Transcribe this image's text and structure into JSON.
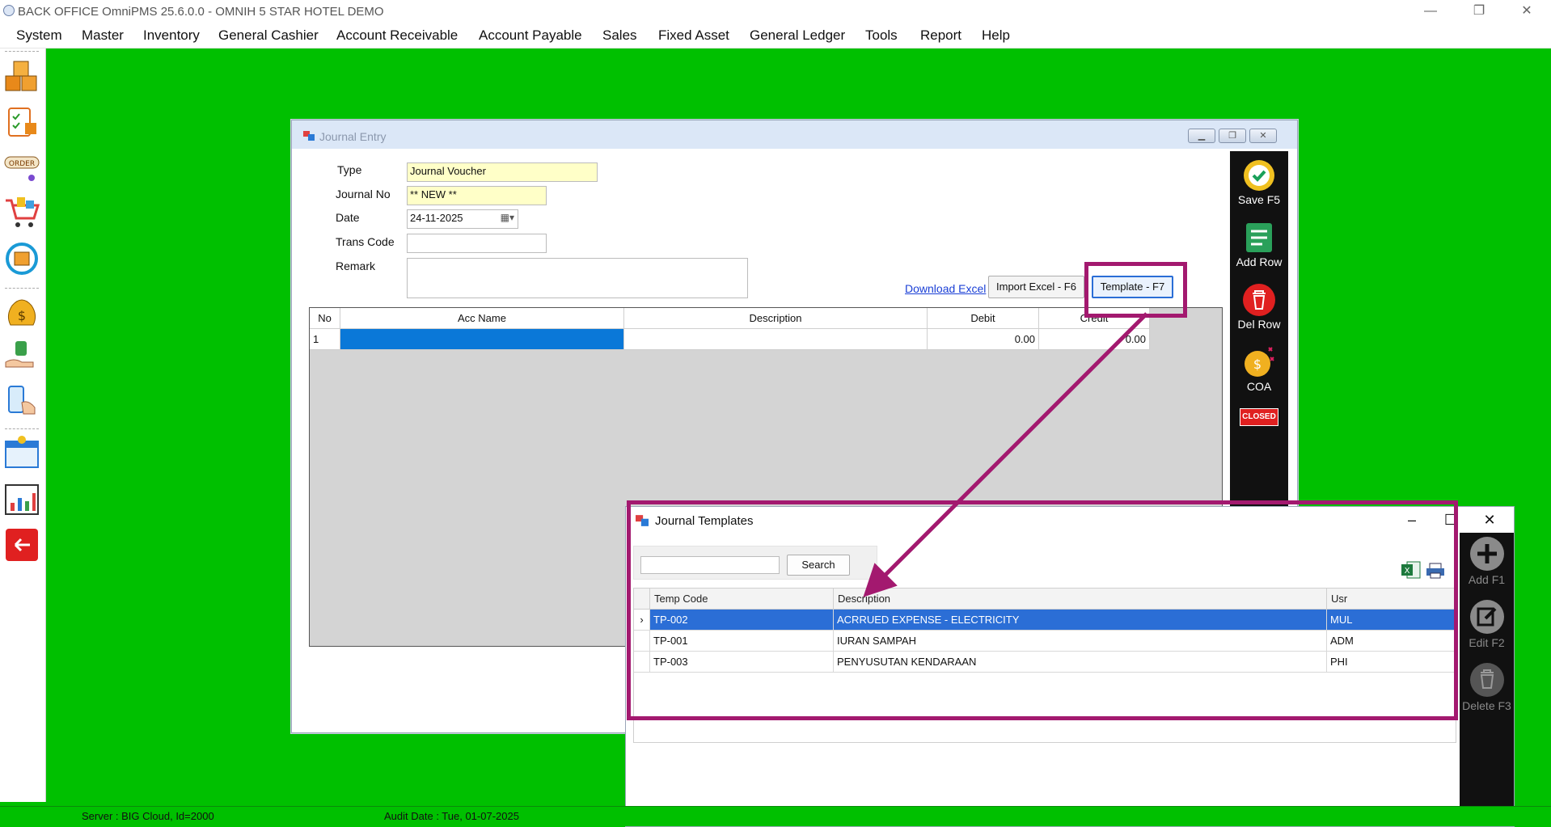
{
  "app": {
    "title": "BACK OFFICE OmniPMS 25.6.0.0 - OMNIH 5 STAR HOTEL DEMO",
    "window_controls": {
      "minimize": "—",
      "restore": "❐",
      "close": "✕"
    }
  },
  "menu": [
    "System",
    "Master",
    "Inventory",
    "General Cashier",
    "Account Receivable",
    "Account Payable",
    "Sales",
    "Fixed Asset",
    "General Ledger",
    "Tools",
    "Report",
    "Help"
  ],
  "left_toolbar": [
    "inventory-boxes-icon",
    "clipboard-task-icon",
    "order-icon",
    "shopping-cart-icon",
    "sync-package-icon",
    "money-bag-icon",
    "payment-hand-icon",
    "mobile-touch-icon",
    "calendar-report-icon",
    "chart-report-icon",
    "exit-icon"
  ],
  "status": {
    "server": "Server : BIG Cloud, Id=2000",
    "audit_date": "Audit Date : Tue, 01-07-2025"
  },
  "journal_entry": {
    "title": "Journal Entry",
    "labels": {
      "type": "Type",
      "journal_no": "Journal No",
      "date": "Date",
      "trans_code": "Trans Code",
      "remark": "Remark"
    },
    "values": {
      "type": "Journal Voucher",
      "journal_no": "** NEW **",
      "date": "24-11-2025",
      "trans_code": "",
      "remark": ""
    },
    "download_excel": "Download Excel",
    "import_button": "Import Excel - F6",
    "template_button": "Template - F7",
    "grid": {
      "columns": [
        "No",
        "Acc Name",
        "Description",
        "Debit",
        "Credit"
      ],
      "rows": [
        {
          "no": "1",
          "acc_name": "",
          "description": "",
          "debit": "0.00",
          "credit": "0.00"
        }
      ]
    },
    "toolbar": {
      "save": "Save F5",
      "add_row": "Add Row",
      "del_row": "Del Row",
      "coa": "COA",
      "closed": "CLOSED"
    }
  },
  "templates_dialog": {
    "title": "Journal Templates",
    "search_value": "",
    "search_button": "Search",
    "columns": [
      "Temp Code",
      "Description",
      "Usr"
    ],
    "rows": [
      {
        "code": "TP-002",
        "description": "ACRRUED EXPENSE - ELECTRICITY",
        "usr": "MUL",
        "selected": true
      },
      {
        "code": "TP-001",
        "description": "IURAN SAMPAH",
        "usr": "ADM",
        "selected": false
      },
      {
        "code": "TP-003",
        "description": "PENYUSUTAN KENDARAAN",
        "usr": "PHI",
        "selected": false
      }
    ],
    "toolbar": {
      "add": "Add F1",
      "edit": "Edit F2",
      "delete": "Delete F3"
    }
  },
  "colors": {
    "desktop": "#00c000",
    "annotation": "#a3196f",
    "selection": "#2b6ed6"
  }
}
